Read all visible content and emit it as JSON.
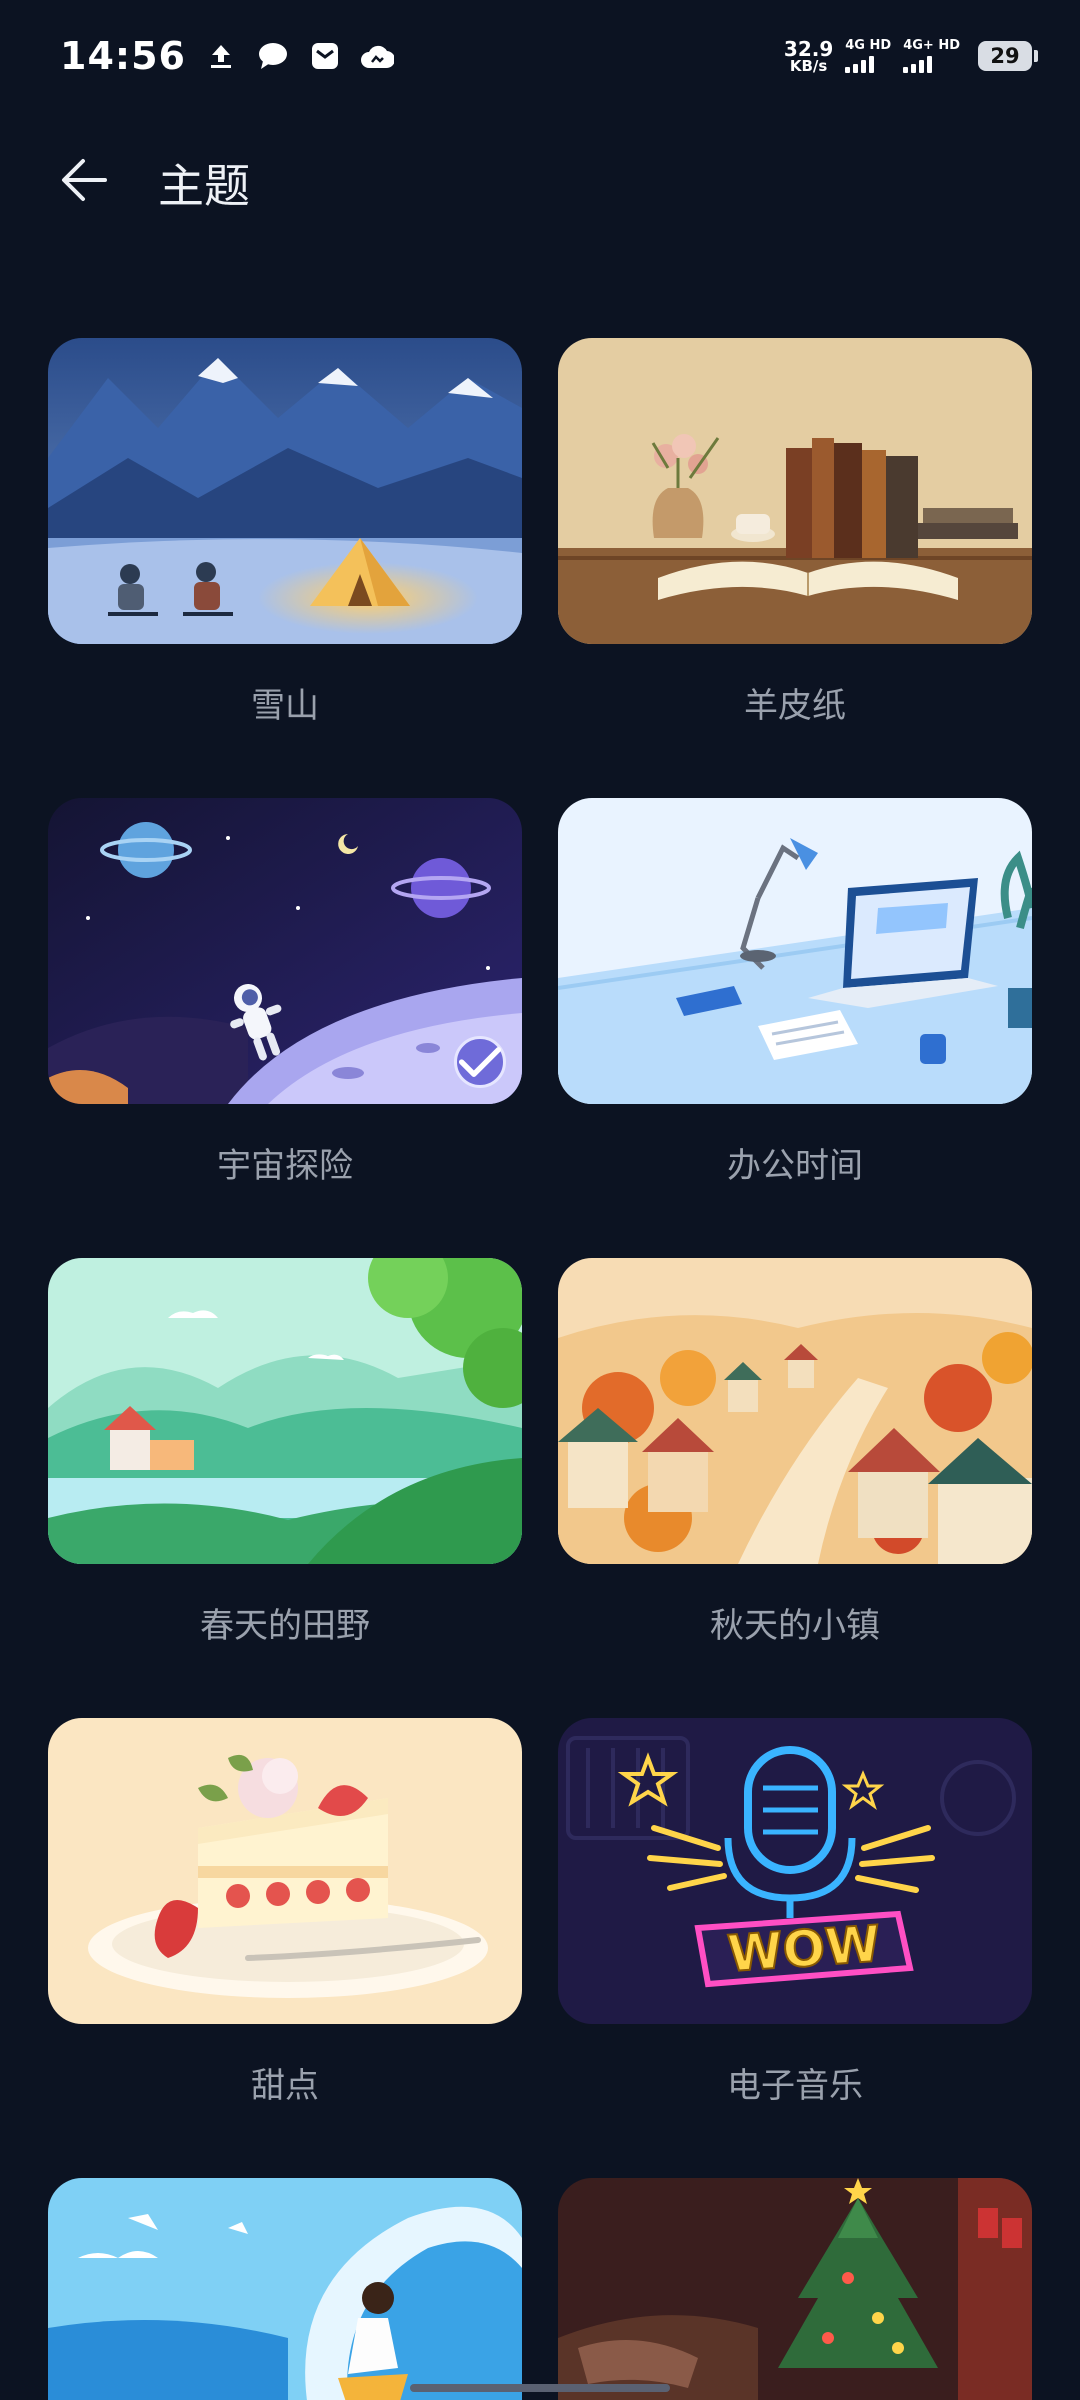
{
  "status_bar": {
    "time": "14:56",
    "net_speed_value": "32.9",
    "net_speed_unit": "KB/s",
    "sim1_label": "4G HD",
    "sim2_label": "4G+ HD",
    "battery_level": "29",
    "left_icons": [
      "upload-icon",
      "chat-bubble-icon",
      "mail-icon",
      "cloud-icon"
    ]
  },
  "header": {
    "title": "主题"
  },
  "themes": [
    {
      "name": "雪山",
      "selected": false
    },
    {
      "name": "羊皮纸",
      "selected": false
    },
    {
      "name": "宇宙探险",
      "selected": true
    },
    {
      "name": "办公时间",
      "selected": false
    },
    {
      "name": "春天的田野",
      "selected": false
    },
    {
      "name": "秋天的小镇",
      "selected": false
    },
    {
      "name": "甜点",
      "selected": false
    },
    {
      "name": "电子音乐",
      "selected": false
    }
  ],
  "electro_badge_text": "WOW",
  "colors": {
    "background": "#0c1322",
    "label": "#9aa1ad",
    "selected_check": "#6f6bd9"
  }
}
